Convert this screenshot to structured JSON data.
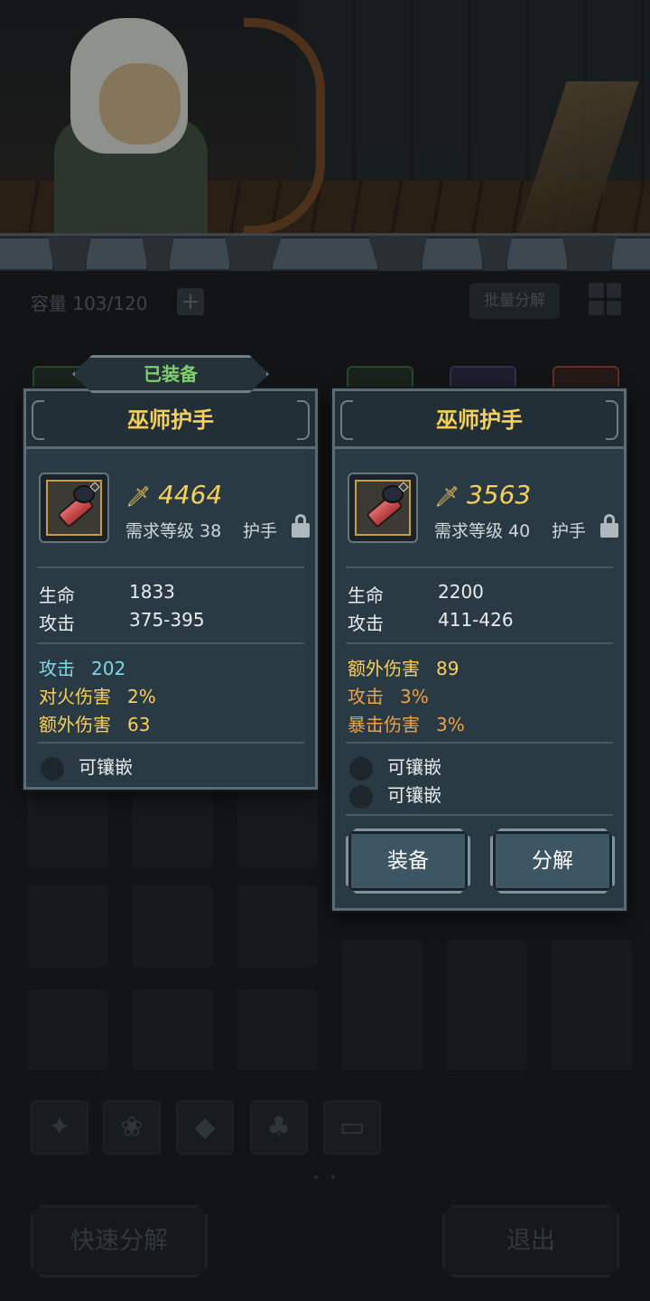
{
  "inventory": {
    "capacity_text": "容量 103/120",
    "add_icon": "plus-icon",
    "batch_label": "批量分解",
    "quick_salvage_label": "快速分解",
    "exit_label": "退出",
    "page_dots": "• •",
    "categories": [
      "weapon-icon",
      "paw-icon",
      "gem-icon",
      "leaf-icon",
      "chest-icon"
    ]
  },
  "equipped_card": {
    "tag": "已装备",
    "title": "巫师护手",
    "power": "4464",
    "req_level": "需求等级 38",
    "slot": "护手",
    "stats": [
      {
        "label": "生命",
        "value": "1833"
      },
      {
        "label": "攻击",
        "value": "375-395"
      }
    ],
    "substats": [
      {
        "label": "攻击",
        "value": "202",
        "color": "#7fd7e3"
      },
      {
        "label": "对火伤害",
        "value": "2%",
        "color": "#f6d05a"
      },
      {
        "label": "额外伤害",
        "value": "63",
        "color": "#f6d05a"
      }
    ],
    "sockets": [
      "可镶嵌"
    ]
  },
  "compare_card": {
    "title": "巫师护手",
    "power": "3563",
    "req_level": "需求等级 40",
    "slot": "护手",
    "stats": [
      {
        "label": "生命",
        "value": "2200"
      },
      {
        "label": "攻击",
        "value": "411-426"
      }
    ],
    "substats": [
      {
        "label": "额外伤害",
        "value": "89",
        "color": "#f6d05a"
      },
      {
        "label": "攻击",
        "value": "3%",
        "color": "#f0a044"
      },
      {
        "label": "暴击伤害",
        "value": "3%",
        "color": "#f0a044"
      }
    ],
    "sockets": [
      "可镶嵌",
      "可镶嵌"
    ],
    "equip_label": "装备",
    "salvage_label": "分解"
  },
  "colors": {
    "gold": "#f6d05a",
    "green": "#7fd06a",
    "panel": "#2a3a44"
  }
}
